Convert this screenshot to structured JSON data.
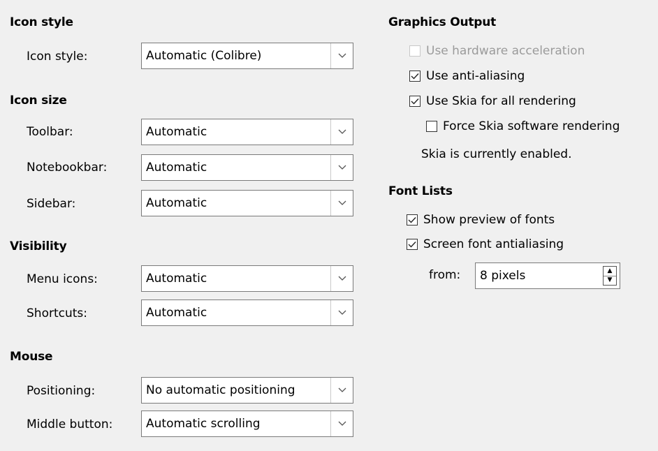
{
  "user_interface": {
    "icon_style": {
      "heading": "Icon style",
      "field_label": "Icon style:",
      "value": "Automatic (Colibre)"
    },
    "icon_size": {
      "heading": "Icon size",
      "toolbar_label": "Toolbar:",
      "toolbar_value": "Automatic",
      "notebookbar_label": "Notebookbar:",
      "notebookbar_value": "Automatic",
      "sidebar_label": "Sidebar:",
      "sidebar_value": "Automatic"
    },
    "visibility": {
      "heading": "Visibility",
      "menu_icons_label": "Menu icons:",
      "menu_icons_value": "Automatic",
      "shortcuts_label": "Shortcuts:",
      "shortcuts_value": "Automatic"
    },
    "mouse": {
      "heading": "Mouse",
      "positioning_label": "Positioning:",
      "positioning_value": "No automatic positioning",
      "middle_button_label": "Middle button:",
      "middle_button_value": "Automatic scrolling"
    }
  },
  "graphics_output": {
    "heading": "Graphics Output",
    "hardware_acceleration": {
      "label": "Use hardware acceleration",
      "checked": false,
      "enabled": false
    },
    "anti_aliasing": {
      "label": "Use anti-aliasing",
      "checked": true,
      "enabled": true
    },
    "skia": {
      "label": "Use Skia for all rendering",
      "checked": true,
      "enabled": true
    },
    "force_skia_software": {
      "label": "Force Skia software rendering",
      "checked": false,
      "enabled": true
    },
    "status": "Skia is currently enabled."
  },
  "font_lists": {
    "heading": "Font Lists",
    "show_preview": {
      "label": "Show preview of fonts",
      "checked": true
    },
    "screen_antialiasing": {
      "label": "Screen font antialiasing",
      "checked": true
    },
    "from_label": "from:",
    "from_value": "8 pixels"
  },
  "colors": {
    "background": "#f0f0f0",
    "field_border": "#7a7a7a",
    "disabled_text": "#9b9b9b"
  }
}
